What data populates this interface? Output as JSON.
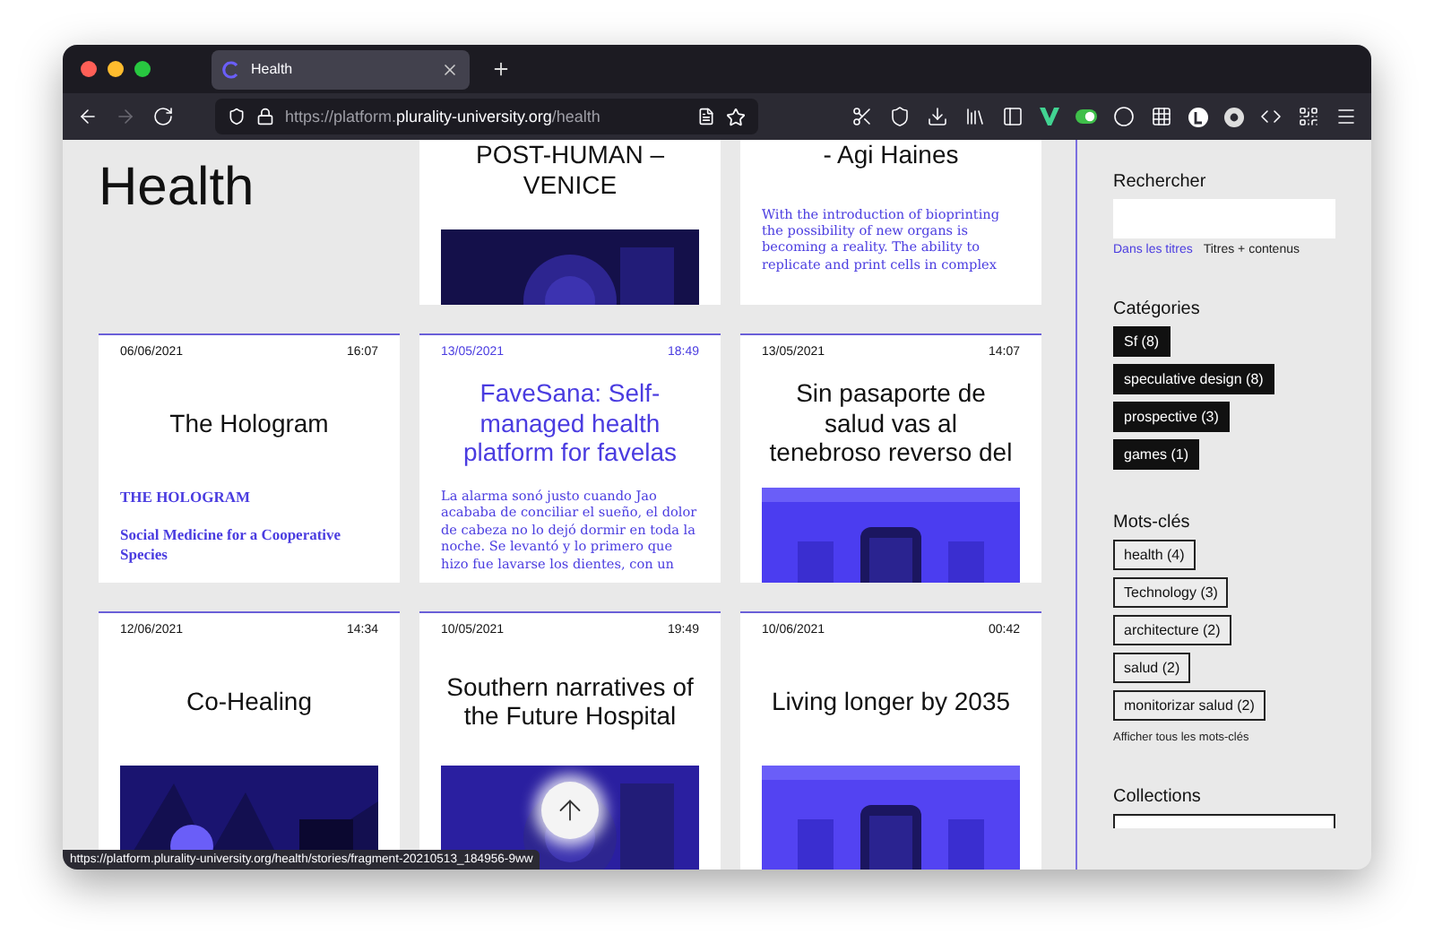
{
  "browser": {
    "tab": {
      "title": "Health",
      "selected": true
    },
    "url": {
      "scheme": "https://platform.",
      "domain": "plurality-university.org",
      "path": "/health"
    },
    "forward_disabled": true
  },
  "page": {
    "heading": "Health"
  },
  "top_row": [
    {
      "title": "POST-HUMAN –\nVENICE"
    },
    {
      "title": "- Agi Haines",
      "body": {
        "kind": "excerpt",
        "text": "With the introduction of bioprinting the possibility of new organs is becoming a reality. The ability to replicate and print cells in complex"
      }
    }
  ],
  "rows": [
    [
      {
        "date": "06/06/2021",
        "time": "16:07",
        "title": "The Hologram",
        "hovered": false,
        "body": {
          "kind": "headings",
          "lines": [
            "THE HOLOGRAM",
            "Social Medicine for a Cooperative Species"
          ]
        }
      },
      {
        "date": "13/05/2021",
        "time": "18:49",
        "title": "FaveSana: Self-managed health platform for favelas",
        "hovered": true,
        "body": {
          "kind": "excerpt",
          "text": "La alarma sonó justo cuando Jao acababa de conciliar el sueño, el dolor de cabeza no lo dejó dormir en toda la noche. Se levantó y lo primero que hizo fue lavarse los dientes, con un"
        }
      },
      {
        "date": "13/05/2021",
        "time": "14:07",
        "title": "Sin pasaporte de\nsalud vas al\ntenebroso reverso del",
        "hovered": false
      }
    ],
    [
      {
        "date": "12/06/2021",
        "time": "14:34",
        "title": "Co-Healing",
        "hovered": false
      },
      {
        "date": "10/05/2021",
        "time": "19:49",
        "title": "Southern narratives of the Future Hospital",
        "hovered": false
      },
      {
        "date": "10/06/2021",
        "time": "00:42",
        "title": "Living longer by 2035",
        "hovered": false
      }
    ]
  ],
  "status_url": "https://platform.plurality-university.org/health/stories/fragment-20210513_184956-9ww",
  "sidebar": {
    "search": {
      "title": "Rechercher",
      "modes": [
        {
          "label": "Dans les titres",
          "selected": true
        },
        {
          "label": "Titres + contenus",
          "selected": false
        }
      ]
    },
    "categories": {
      "title": "Catégories",
      "items": [
        "Sf (8)",
        "speculative design (8)",
        "prospective (3)",
        "games (1)"
      ]
    },
    "keywords": {
      "title": "Mots-clés",
      "items": [
        "health (4)",
        "Technology (3)",
        "architecture (2)",
        "salud (2)",
        "monitorizar salud (2)"
      ],
      "more": "Afficher tous les mots-clés"
    },
    "collections": {
      "title": "Collections"
    }
  }
}
